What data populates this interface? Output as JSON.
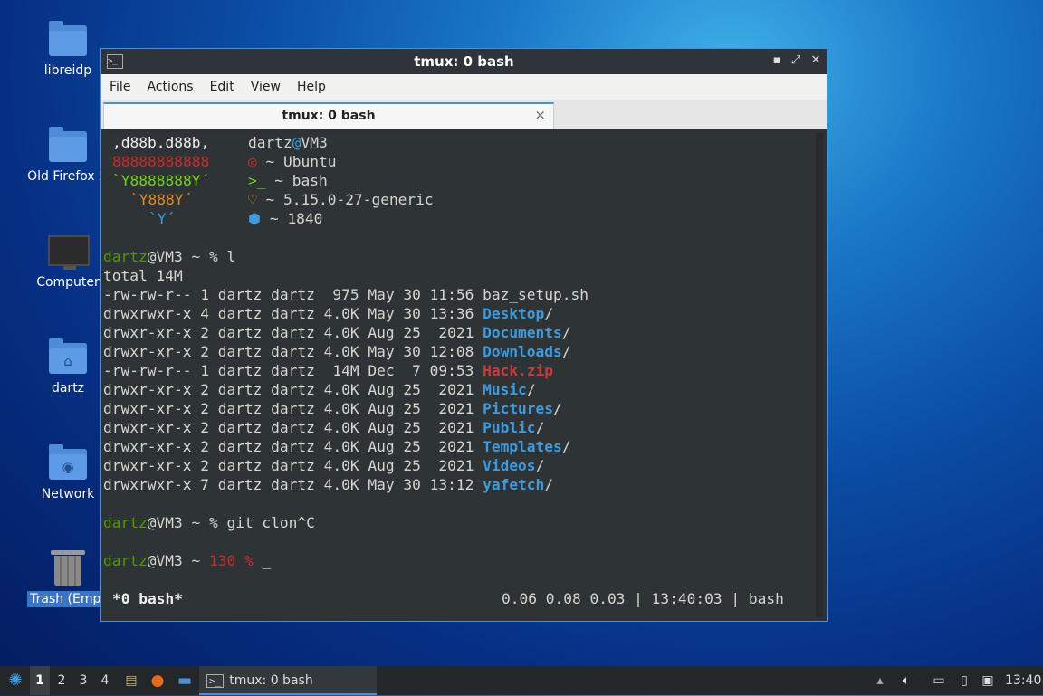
{
  "desktop": {
    "icons": [
      {
        "label": "libreidp",
        "icon": "folder-icon"
      },
      {
        "label": "Old Firefox D",
        "icon": "folder-icon"
      },
      {
        "label": "Computer",
        "icon": "computer-icon"
      },
      {
        "label": "dartz",
        "icon": "home-folder-icon"
      },
      {
        "label": "Network",
        "icon": "network-folder-icon"
      },
      {
        "label": "Trash (Empt",
        "icon": "trash-icon"
      }
    ]
  },
  "window": {
    "title": "tmux: 0 bash",
    "menu": [
      "File",
      "Actions",
      "Edit",
      "View",
      "Help"
    ],
    "tab_label": "tmux: 0 bash",
    "tab_close": "×"
  },
  "terminal": {
    "fetch": {
      "art": [
        ",d88b.d88b,",
        "88888888888",
        "`Y8888888Y´",
        "`Y888Y´",
        "`Y´"
      ],
      "user": "dartz",
      "at": "@",
      "host": "VM3",
      "rows": [
        {
          "glyph": "◎",
          "label": "~ Ubuntu"
        },
        {
          "glyph": ">_",
          "label": "~ bash"
        },
        {
          "glyph": "♡",
          "label": "~ 5.15.0-27-generic"
        },
        {
          "glyph": "⬢",
          "label": "~ 1840"
        }
      ]
    },
    "prompt_user": "dartz",
    "prompt_rest": "@VM3 ~ % ",
    "cmd1": "l",
    "total": "total 14M",
    "listing": [
      {
        "meta": "-rw-rw-r-- 1 dartz dartz  975 May 30 11:56 ",
        "name": "baz_setup.sh",
        "suffix": "",
        "kind": "file"
      },
      {
        "meta": "drwxrwxr-x 4 dartz dartz 4.0K May 30 13:36 ",
        "name": "Desktop",
        "suffix": "/",
        "kind": "dir"
      },
      {
        "meta": "drwxr-xr-x 2 dartz dartz 4.0K Aug 25  2021 ",
        "name": "Documents",
        "suffix": "/",
        "kind": "dir"
      },
      {
        "meta": "drwxr-xr-x 2 dartz dartz 4.0K May 30 12:08 ",
        "name": "Downloads",
        "suffix": "/",
        "kind": "dir"
      },
      {
        "meta": "-rw-rw-r-- 1 dartz dartz  14M Dec  7 09:53 ",
        "name": "Hack.zip",
        "suffix": "",
        "kind": "archive"
      },
      {
        "meta": "drwxr-xr-x 2 dartz dartz 4.0K Aug 25  2021 ",
        "name": "Music",
        "suffix": "/",
        "kind": "dir"
      },
      {
        "meta": "drwxr-xr-x 2 dartz dartz 4.0K Aug 25  2021 ",
        "name": "Pictures",
        "suffix": "/",
        "kind": "dir"
      },
      {
        "meta": "drwxr-xr-x 2 dartz dartz 4.0K Aug 25  2021 ",
        "name": "Public",
        "suffix": "/",
        "kind": "dir"
      },
      {
        "meta": "drwxr-xr-x 2 dartz dartz 4.0K Aug 25  2021 ",
        "name": "Templates",
        "suffix": "/",
        "kind": "dir"
      },
      {
        "meta": "drwxr-xr-x 2 dartz dartz 4.0K Aug 25  2021 ",
        "name": "Videos",
        "suffix": "/",
        "kind": "dir"
      },
      {
        "meta": "drwxrwxr-x 7 dartz dartz 4.0K May 30 13:12 ",
        "name": "yafetch",
        "suffix": "/",
        "kind": "dir"
      }
    ],
    "cmd2": "git clon^C",
    "exit_code": "130 %",
    "cursor": "_",
    "status_left": "*0 bash*",
    "status_right": "0.06 0.08 0.03 | 13:40:03 | bash"
  },
  "taskbar": {
    "workspaces": [
      "1",
      "2",
      "3",
      "4"
    ],
    "active_workspace": "1",
    "task_label": "tmux: 0 bash",
    "clock": "13:40"
  },
  "colors": {
    "accent": "#4a90d9",
    "terminal_bg": "#2e3436",
    "prompt_green": "#4e9a06",
    "dir_blue": "#3b9ce0",
    "error_red": "#cc2a2a"
  }
}
